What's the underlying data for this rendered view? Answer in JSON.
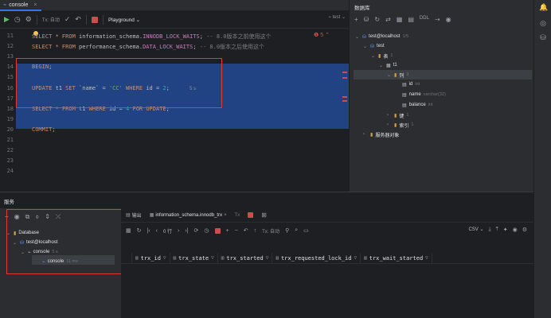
{
  "tab": {
    "title": "console",
    "close": "×"
  },
  "toolbar": {
    "tx_mode": "Tx: 自动",
    "playground": "Playground",
    "datasource": "test"
  },
  "editor": {
    "warnings": "5",
    "lines": [
      {
        "num": "11",
        "parts": [
          {
            "t": "SELECT * FROM ",
            "c": "kw"
          },
          {
            "t": "information_schema.",
            "c": ""
          },
          {
            "t": "INNODB_LOCK_WAITS",
            "c": "tbl"
          },
          {
            "t": "; ",
            "c": ""
          },
          {
            "t": "-- 8.0版本之前使用这个",
            "c": "cmt"
          }
        ]
      },
      {
        "num": "12",
        "parts": [
          {
            "t": "SELECT * FROM ",
            "c": "kw"
          },
          {
            "t": "performance_schema.",
            "c": ""
          },
          {
            "t": "DATA_LOCK_WAITS",
            "c": "tbl"
          },
          {
            "t": "; ",
            "c": ""
          },
          {
            "t": "-- 8.0版本之后使用这个",
            "c": "cmt"
          }
        ]
      },
      {
        "num": "13",
        "parts": []
      },
      {
        "num": "14",
        "parts": [
          {
            "t": "BEGIN",
            "c": "kw"
          },
          {
            "t": ";",
            "c": ""
          }
        ]
      },
      {
        "num": "15",
        "parts": []
      },
      {
        "num": "16",
        "parts": [
          {
            "t": "UPDATE ",
            "c": "kw"
          },
          {
            "t": "t1 ",
            "c": ""
          },
          {
            "t": "SET ",
            "c": "kw"
          },
          {
            "t": "`name` = ",
            "c": ""
          },
          {
            "t": "'CC' ",
            "c": "str"
          },
          {
            "t": "WHERE ",
            "c": "kw"
          },
          {
            "t": "id = ",
            "c": ""
          },
          {
            "t": "2",
            "c": "num"
          },
          {
            "t": ";",
            "c": ""
          }
        ]
      },
      {
        "num": "17",
        "parts": []
      },
      {
        "num": "18",
        "parts": [
          {
            "t": "SELECT * FROM ",
            "c": "kw"
          },
          {
            "t": "t1 ",
            "c": ""
          },
          {
            "t": "WHERE ",
            "c": "kw"
          },
          {
            "t": "id = ",
            "c": ""
          },
          {
            "t": "4 ",
            "c": "num"
          },
          {
            "t": "FOR UPDATE",
            "c": "kw"
          },
          {
            "t": ";",
            "c": ""
          }
        ]
      },
      {
        "num": "19",
        "parts": []
      },
      {
        "num": "20",
        "parts": [
          {
            "t": "COMMIT",
            "c": "kw"
          },
          {
            "t": ";",
            "c": ""
          }
        ]
      },
      {
        "num": "21",
        "parts": []
      },
      {
        "num": "22",
        "parts": []
      },
      {
        "num": "23",
        "parts": []
      },
      {
        "num": "24",
        "parts": []
      }
    ],
    "exec_time": "5 s"
  },
  "db": {
    "title": "数据库",
    "tree": [
      {
        "label": "test@localhost",
        "meta": "1/5"
      },
      {
        "label": "test",
        "meta": ""
      },
      {
        "label": "表",
        "meta": "1"
      },
      {
        "label": "t1",
        "meta": ""
      },
      {
        "label": "列",
        "meta": "3"
      },
      {
        "label": "id",
        "meta": "int"
      },
      {
        "label": "name",
        "meta": "varchar(32)"
      },
      {
        "label": "balance",
        "meta": "int"
      },
      {
        "label": "键",
        "meta": "1"
      },
      {
        "label": "索引",
        "meta": "1"
      },
      {
        "label": "服务器对象",
        "meta": ""
      }
    ]
  },
  "services": {
    "title": "服务",
    "tree": [
      {
        "label": "Database",
        "meta": ""
      },
      {
        "label": "test@localhost",
        "meta": ""
      },
      {
        "label": "console",
        "meta": "5 s"
      },
      {
        "label": "console",
        "meta": "11 ms"
      }
    ],
    "tabs": [
      "输出",
      "information_schema.innodb_trx",
      "Tx"
    ],
    "rows": "0 行",
    "tx": "Tx: 自动",
    "export": "CSV",
    "columns": [
      "trx_id",
      "trx_state",
      "trx_started",
      "trx_requested_lock_id",
      "trx_wait_started"
    ]
  }
}
